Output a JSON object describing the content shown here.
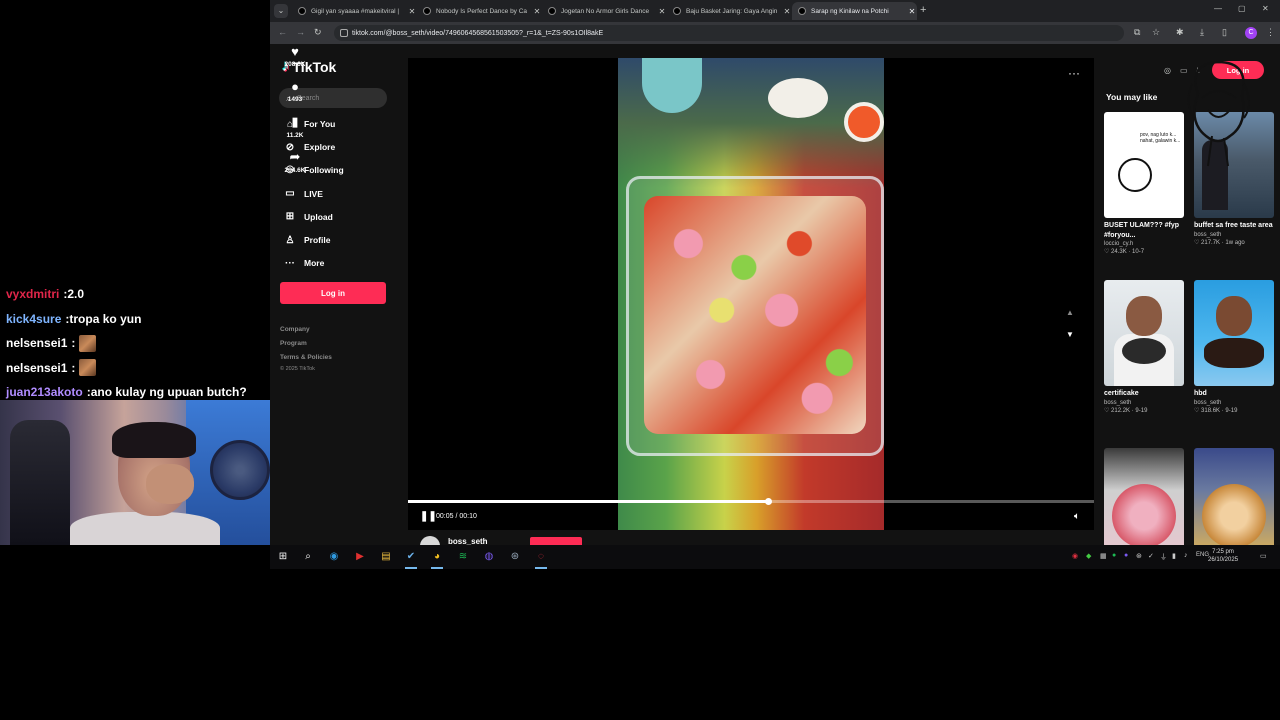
{
  "overlay": {
    "chat": [
      {
        "user": "vyxdmitri",
        "sep": " : ",
        "msg": "2.0",
        "color": "#e0264a",
        "emote": false
      },
      {
        "user": "kick4sure",
        "sep": " : ",
        "msg": "tropa ko yun",
        "color": "#7fb5ff",
        "emote": false
      },
      {
        "user": "nelsensei1",
        "sep": " : ",
        "msg": "",
        "color": "#ffffff",
        "emote": true
      },
      {
        "user": "nelsensei1",
        "sep": " : ",
        "msg": "",
        "color": "#ffffff",
        "emote": true
      },
      {
        "user": "juan213akoto",
        "sep": " : ",
        "msg": "ano kulay ng upuan butch?",
        "color": "#b08cff",
        "emote": false
      }
    ]
  },
  "browser": {
    "tabs": [
      {
        "title": "Gigil yan syaaaa #makeitviral |",
        "active": false
      },
      {
        "title": "Nobody Is Perfect Dance by Ca",
        "active": false
      },
      {
        "title": "Jogetan No Armor Girls Dance",
        "active": false
      },
      {
        "title": "Baju Basket Jaring: Gaya Angin",
        "active": false
      },
      {
        "title": "Sarap ng Kinilaw na Potchi",
        "active": true
      }
    ],
    "url": "tiktok.com/@boss_seth/video/7496064568561503505?_r=1&_t=ZS-90s1OIl8akE"
  },
  "tiktok": {
    "brand": "TikTok",
    "search_placeholder": "Search",
    "nav": [
      {
        "label": "For You",
        "icon": "home-icon",
        "glyph": "⌂"
      },
      {
        "label": "Explore",
        "icon": "compass-icon",
        "glyph": "⊘"
      },
      {
        "label": "Following",
        "icon": "following-icon",
        "glyph": "⚇"
      },
      {
        "label": "LIVE",
        "icon": "live-icon",
        "glyph": "▭"
      },
      {
        "label": "Upload",
        "icon": "upload-icon",
        "glyph": "⊞"
      },
      {
        "label": "Profile",
        "icon": "profile-icon",
        "glyph": "♙"
      },
      {
        "label": "More",
        "icon": "more-icon",
        "glyph": "···"
      }
    ],
    "login_label": "Log in",
    "footer": [
      "Company",
      "Program",
      "Terms & Policies"
    ],
    "copyright": "© 2025 TikTok",
    "header_login": "Log in",
    "player": {
      "time": "00:05 / 00:10",
      "progress": 0.5
    },
    "actions": [
      {
        "name": "like",
        "icon": "heart-icon",
        "glyph": "♥",
        "count": "208.6K"
      },
      {
        "name": "comment",
        "icon": "comment-icon",
        "glyph": "●",
        "count": "1493"
      },
      {
        "name": "save",
        "icon": "bookmark-icon",
        "glyph": "▮",
        "count": "11.2K"
      },
      {
        "name": "share",
        "icon": "share-icon",
        "glyph": "➦",
        "count": "284.6K"
      }
    ],
    "creator": "boss_seth",
    "recommended_title": "You may like",
    "recommended": [
      {
        "caption": "BUSET ULAM??? #fyp #foryou...",
        "author": "loccio_cy.h",
        "meta": "♡ 24.3K · 10-7",
        "thumb": "t1"
      },
      {
        "caption": "buffet sa free taste area",
        "author": "boss_seth",
        "meta": "♡ 217.7K · 1w ago",
        "thumb": "t2"
      },
      {
        "caption": "certificake",
        "author": "boss_seth",
        "meta": "♡ 212.2K · 9-19",
        "thumb": "t3"
      },
      {
        "caption": "hbd",
        "author": "boss_seth",
        "meta": "♡ 318.6K · 9-19",
        "thumb": "t4"
      },
      {
        "caption": "",
        "author": "",
        "meta": "",
        "thumb": "t5"
      },
      {
        "caption": "",
        "author": "",
        "meta": "",
        "thumb": "t6"
      }
    ],
    "thumb_text": "pov, nag luto k...\nnahat, galawin k..."
  },
  "taskbar": {
    "time": "7:25 pm",
    "date": "26/10/2025",
    "lang": "ENG"
  },
  "colors": {
    "accent": "#fe2c55",
    "background": "#121212"
  }
}
